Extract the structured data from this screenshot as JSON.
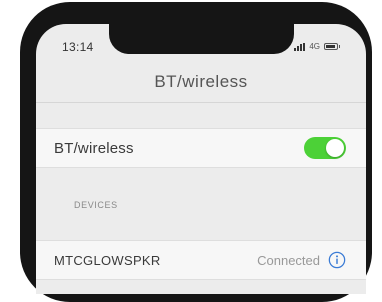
{
  "status_bar": {
    "time": "13:14",
    "network": "4G"
  },
  "nav": {
    "title": "BT/wireless"
  },
  "bt_row": {
    "label": "BT/wireless",
    "toggle_on": true
  },
  "devices": {
    "header": "DEVICES",
    "items": [
      {
        "name": "MTCGLOWSPKR",
        "status": "Connected"
      }
    ]
  },
  "colors": {
    "accent": "#4cd137",
    "info_blue": "#3a7bd5",
    "screen_bg": "#ececec",
    "cell_bg": "#f7f7f7",
    "phone_frame": "#151515"
  },
  "icons": {
    "info": "info-icon",
    "signal": "signal-icon",
    "battery": "battery-icon"
  }
}
